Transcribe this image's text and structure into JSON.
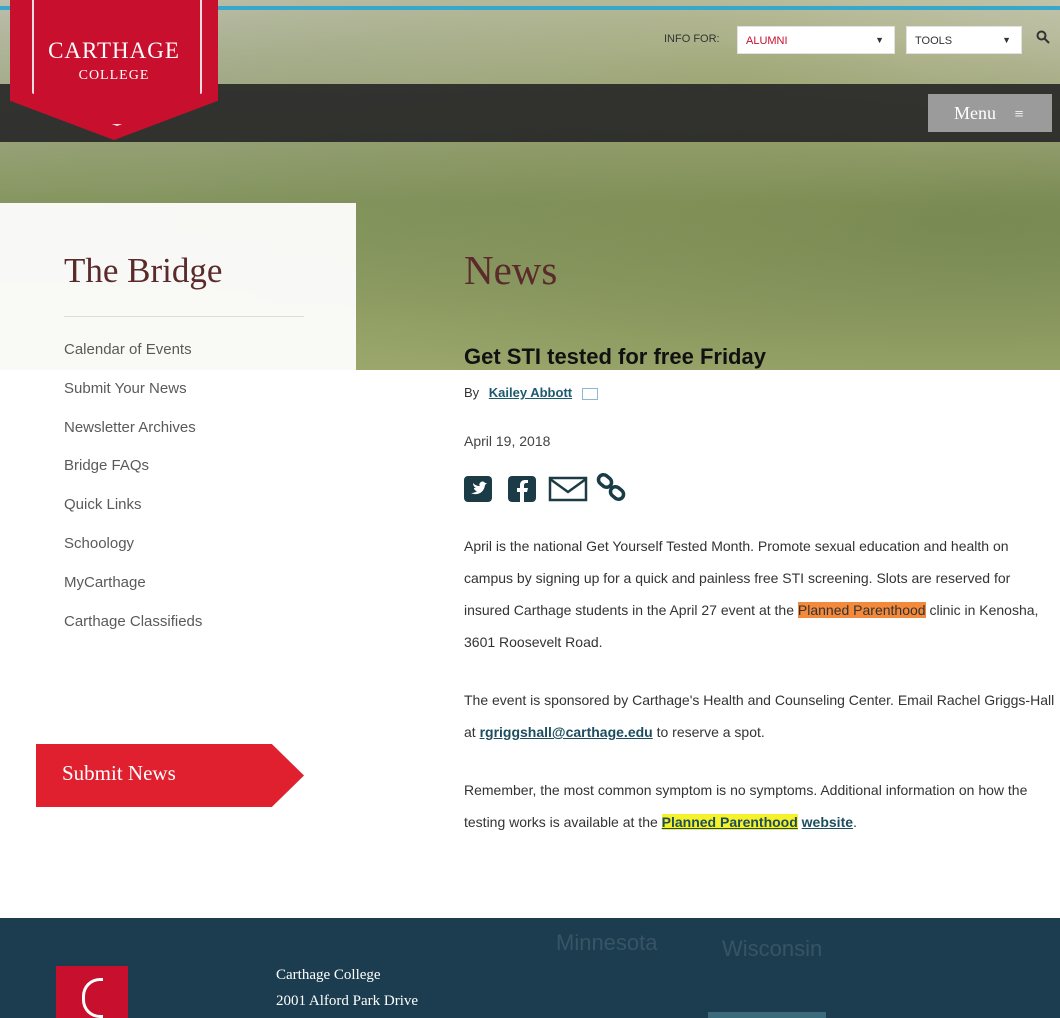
{
  "logo": {
    "title": "CARTHAGE",
    "subtitle": "COLLEGE"
  },
  "header": {
    "info_for_label": "INFO FOR:",
    "audience_value": "ALUMNI",
    "tools_value": "TOOLS",
    "search_icon": "search-icon",
    "menu_label": "Menu",
    "menu_icon": "hamburger-icon"
  },
  "sidebar": {
    "title": "The Bridge",
    "items": [
      {
        "label": "Calendar of Events"
      },
      {
        "label": "Submit Your News"
      },
      {
        "label": "Newsletter Archives"
      },
      {
        "label": "Bridge FAQs"
      },
      {
        "label": "Quick Links"
      },
      {
        "label": "Schoology"
      },
      {
        "label": "MyCarthage"
      },
      {
        "label": "Carthage Classifieds"
      }
    ],
    "submit_button": "Submit News"
  },
  "main": {
    "section_title": "News",
    "article": {
      "title": "Get STI tested for free Friday",
      "by_label": "By",
      "author": "Kailey Abbott",
      "date": "April 19, 2018",
      "share_icons": [
        "twitter-icon",
        "facebook-icon",
        "email-icon",
        "link-icon"
      ],
      "p1_a": "April is the national Get Yourself Tested Month. Promote sexual education and health on campus by signing up for a quick and painless free STI screening. Slots are reserved for insured Carthage students in the April 27 event at the ",
      "p1_highlight": "Planned Parenthood",
      "p1_b": " clinic in Kenosha, 3601 Roosevelt Road.",
      "p2_a": "The event is sponsored by Carthage's Health and Counseling Center. Email Rachel Griggs-Hall at ",
      "p2_email": "rgriggshall@carthage.edu",
      "p2_b": " to reserve a spot.",
      "p3_a": "Remember, the most common symptom is no symptoms. Additional information on how the testing works is available at the ",
      "p3_link_highlight": "Planned Parenthood",
      "p3_link_rest": "website",
      "p3_b": "."
    }
  },
  "footer": {
    "name": "Carthage College",
    "address": "2001 Alford Park Drive",
    "map_labels": [
      "Minnesota",
      "Wisconsin"
    ]
  },
  "colors": {
    "brand_red": "#c8102e",
    "footer_teal": "#1b3d4f",
    "accent_blue": "#3aa6c9"
  }
}
